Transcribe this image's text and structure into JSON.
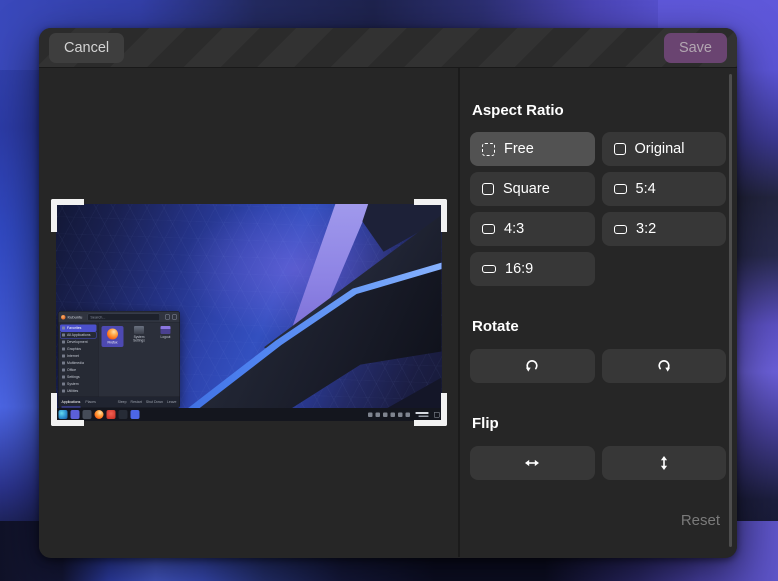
{
  "dialog": {
    "cancel_label": "Cancel",
    "save_label": "Save"
  },
  "panel": {
    "aspect_heading": "Aspect Ratio",
    "aspect_options": [
      {
        "label": "Free",
        "selected": true
      },
      {
        "label": "Original",
        "selected": false
      },
      {
        "label": "Square",
        "selected": false
      },
      {
        "label": "5:4",
        "selected": false
      },
      {
        "label": "4:3",
        "selected": false
      },
      {
        "label": "3:2",
        "selected": false
      },
      {
        "label": "16:9",
        "selected": false
      }
    ],
    "rotate_heading": "Rotate",
    "flip_heading": "Flip",
    "reset_label": "Reset"
  },
  "preview": {
    "screenshot": {
      "launcher": {
        "title": "Kubuntu",
        "search_placeholder": "Search...",
        "sidebar_items": [
          "Favorites",
          "All Applications",
          "Development",
          "Graphics",
          "Internet",
          "Multimedia",
          "Office",
          "Settings",
          "System",
          "Utilities"
        ],
        "app_tiles": [
          "Firefox",
          "System Settings",
          "Logout"
        ],
        "footer_tabs": [
          "Applications",
          "Places"
        ],
        "power_actions": [
          "Sleep",
          "Restart",
          "Shut Down",
          "Leave"
        ]
      },
      "taskbar_icons": [
        {
          "name": "kde-menu-icon",
          "color": "radial-gradient(circle at 35% 35%, #66d9ec, #2f96d2 50%, #1a55a0)"
        },
        {
          "name": "files-icon",
          "color": "#5b5fd8"
        },
        {
          "name": "inactive-app-icon",
          "color": "#454b58"
        },
        {
          "name": "firefox-icon",
          "color": "radial-gradient(circle at 62% 30%, #ffd79e 5%, #ffae50 30%, #ff7a1e 60%, #d93a1e 90%)"
        },
        {
          "name": "red-app-icon",
          "color": "radial-gradient(circle at 50% 40%, #f26052, #c42b20)"
        },
        {
          "name": "dark-app-icon",
          "color": "#262b36"
        },
        {
          "name": "blue-app-icon",
          "color": "#4c66e6"
        }
      ]
    }
  },
  "colors": {
    "save_button": "#6a4471",
    "option_button": "#373737",
    "selected_option": "#525252",
    "dialog_bg": "#262626",
    "headerbar_stripe_dark": "#2b2b2b",
    "headerbar_stripe_light": "#323232"
  }
}
